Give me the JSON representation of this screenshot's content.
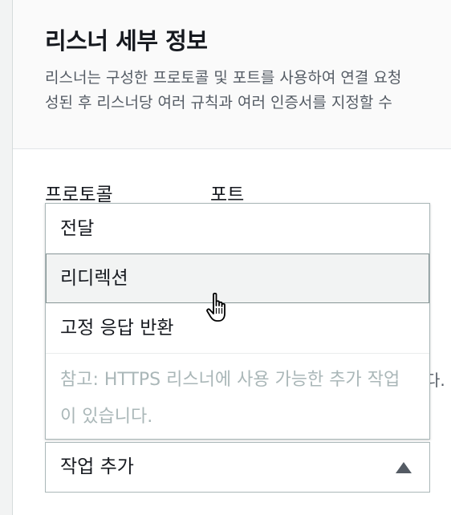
{
  "panel": {
    "title": "리스너 세부 정보",
    "description_lines": [
      "리스너는 구성한 프로토콜 및 포트를 사용하여 연결 요청",
      "성된 후 리스너당 여러 규칙과 여러 인증서를 지정할 수"
    ]
  },
  "fields": {
    "protocol_label": "프로토콜",
    "port_label": "포트"
  },
  "truncated_text": "다.",
  "dropdown": {
    "options": [
      "전달",
      "리디렉션",
      "고정 응답 반환"
    ],
    "highlighted_index": 1,
    "note": "참고: HTTPS 리스너에 사용 가능한 추가 작업이 있습니다."
  },
  "action_select": {
    "value": "작업 추가",
    "expanded": true,
    "caret_icon": "caret-up-icon"
  },
  "cursor": {
    "icon": "hand-pointer-icon"
  }
}
